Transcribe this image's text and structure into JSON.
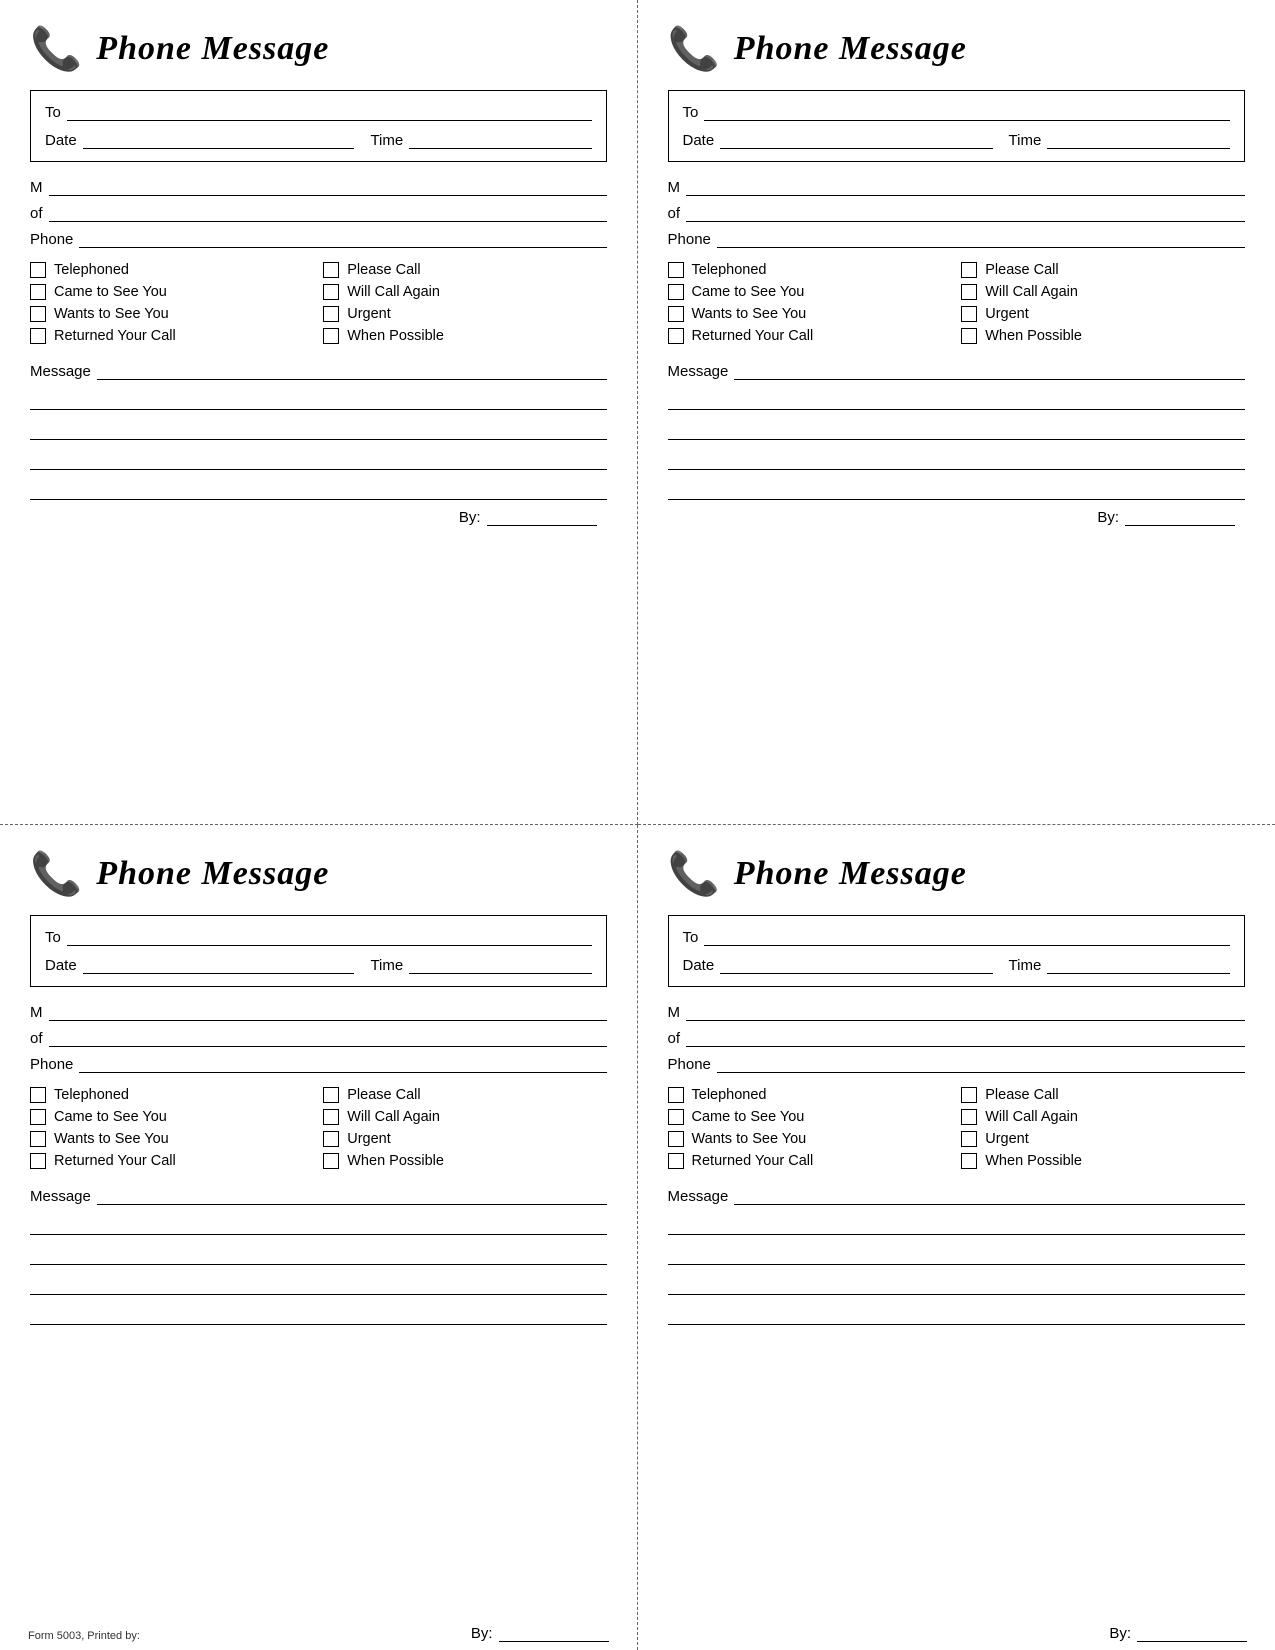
{
  "cards": [
    {
      "id": "card-1",
      "title": "Phone Message",
      "fields": {
        "to_label": "To",
        "date_label": "Date",
        "time_label": "Time",
        "m_label": "M",
        "of_label": "of",
        "phone_label": "Phone",
        "message_label": "Message",
        "by_label": "By:"
      },
      "checkboxes": {
        "col1": [
          "Telephoned",
          "Came to See You",
          "Wants to See You",
          "Returned Your Call"
        ],
        "col2": [
          "Please Call",
          "Will Call Again",
          "Urgent",
          "When Possible"
        ]
      }
    },
    {
      "id": "card-2",
      "title": "Phone Message",
      "fields": {
        "to_label": "To",
        "date_label": "Date",
        "time_label": "Time",
        "m_label": "M",
        "of_label": "of",
        "phone_label": "Phone",
        "message_label": "Message",
        "by_label": "By:"
      },
      "checkboxes": {
        "col1": [
          "Telephoned",
          "Came to See You",
          "Wants to See You",
          "Returned Your Call"
        ],
        "col2": [
          "Please Call",
          "Will Call Again",
          "Urgent",
          "When Possible"
        ]
      }
    },
    {
      "id": "card-3",
      "title": "Phone Message",
      "fields": {
        "to_label": "To",
        "date_label": "Date",
        "time_label": "Time",
        "m_label": "M",
        "of_label": "of",
        "phone_label": "Phone",
        "message_label": "Message",
        "by_label": "By:"
      },
      "checkboxes": {
        "col1": [
          "Telephoned",
          "Came to See You",
          "Wants to See You",
          "Returned Your Call"
        ],
        "col2": [
          "Please Call",
          "Will Call Again",
          "Urgent",
          "When Possible"
        ]
      }
    },
    {
      "id": "card-4",
      "title": "Phone Message",
      "fields": {
        "to_label": "To",
        "date_label": "Date",
        "time_label": "Time",
        "m_label": "M",
        "of_label": "of",
        "phone_label": "Phone",
        "message_label": "Message",
        "by_label": "By:"
      },
      "checkboxes": {
        "col1": [
          "Telephoned",
          "Came to See You",
          "Wants to See You",
          "Returned Your Call"
        ],
        "col2": [
          "Please Call",
          "Will Call Again",
          "Urgent",
          "When Possible"
        ]
      }
    }
  ],
  "footer": {
    "form_number": "Form 5003, Printed by:",
    "by_label": "By:"
  },
  "phone_icon": "📞"
}
